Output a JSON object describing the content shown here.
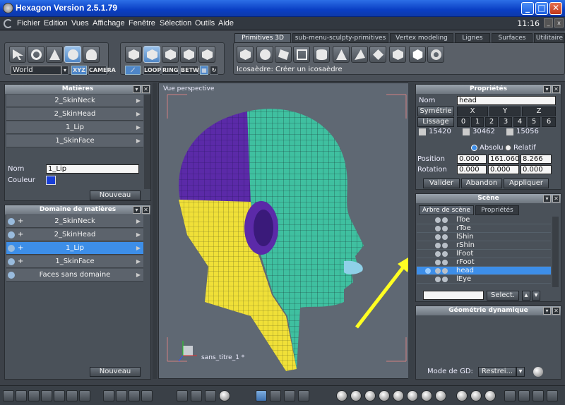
{
  "window": {
    "title": "Hexagon Version 2.5.1.79",
    "min": "_",
    "max": "□",
    "close": "✕"
  },
  "menu": {
    "items": [
      "Fichier",
      "Edition",
      "Vues",
      "Affichage",
      "Fenêtre",
      "Sélection",
      "Outils",
      "Aide"
    ],
    "clock": "11:16",
    "btn_min": "_",
    "btn_close": "x"
  },
  "toolbar": {
    "world_label": "World",
    "xyz_label": "XYZ",
    "camera_label": "CAMERA",
    "loop_label": "LOOP",
    "ring_label": "RING",
    "betw_label": "BETW",
    "status_text": "Icosaèdre: Créer un icosaèdre"
  },
  "tabs": [
    "Primitives 3D",
    "sub-menu-sculpty-primitives",
    "Vertex modeling",
    "Lignes",
    "Surfaces",
    "Utilitaire"
  ],
  "matieres": {
    "title": "Matières",
    "items": [
      "2_SkinNeck",
      "2_SkinHead",
      "1_Lip",
      "1_SkinFace"
    ],
    "nom_label": "Nom",
    "nom_value": "1_Lip",
    "couleur_label": "Couleur",
    "couleur": "#1a3fd6",
    "nouveau": "Nouveau"
  },
  "domaine": {
    "title": "Domaine de matières",
    "items": [
      "2_SkinNeck",
      "2_SkinHead",
      "1_Lip",
      "1_SkinFace",
      "Faces sans domaine"
    ],
    "selected_index": 2,
    "nouveau": "Nouveau"
  },
  "viewport": {
    "label": "Vue perspective",
    "doc_name": "sans_titre_1 *"
  },
  "proprietes": {
    "title": "Propriétés",
    "nom_label": "Nom",
    "nom_value": "head",
    "symetrie": "Symétrie",
    "x": "X",
    "y": "Y",
    "z": "Z",
    "lissage": "Lissage",
    "levels": [
      "0",
      "1",
      "2",
      "3",
      "4",
      "5",
      "6"
    ],
    "counts": [
      "15420",
      "30462",
      "15056"
    ],
    "absolu": "Absolu",
    "relatif": "Relatif",
    "position_label": "Position",
    "position": [
      "0.000",
      "161.060",
      "8.266"
    ],
    "rotation_label": "Rotation",
    "rotation": [
      "0.000",
      "0.000",
      "0.000"
    ],
    "valider": "Valider",
    "abandon": "Abandon",
    "appliquer": "Appliquer"
  },
  "scene": {
    "title": "Scène",
    "tab_tree": "Arbre de scène",
    "tab_props": "Propriétés",
    "items": [
      "lToe",
      "rToe",
      "lShin",
      "rShin",
      "lFoot",
      "rFoot",
      "head",
      "lEye"
    ],
    "selected": "head",
    "select_btn": "Select."
  },
  "geometrie": {
    "title": "Géométrie dynamique",
    "mode_label": "Mode de GD:",
    "mode_value": "Restrei..."
  },
  "colors": {
    "purple": "#5b2aa8",
    "teal": "#3fc0a0",
    "yellow": "#f0e038",
    "arrow": "#ffff22",
    "accent": "#3d8ee8"
  }
}
